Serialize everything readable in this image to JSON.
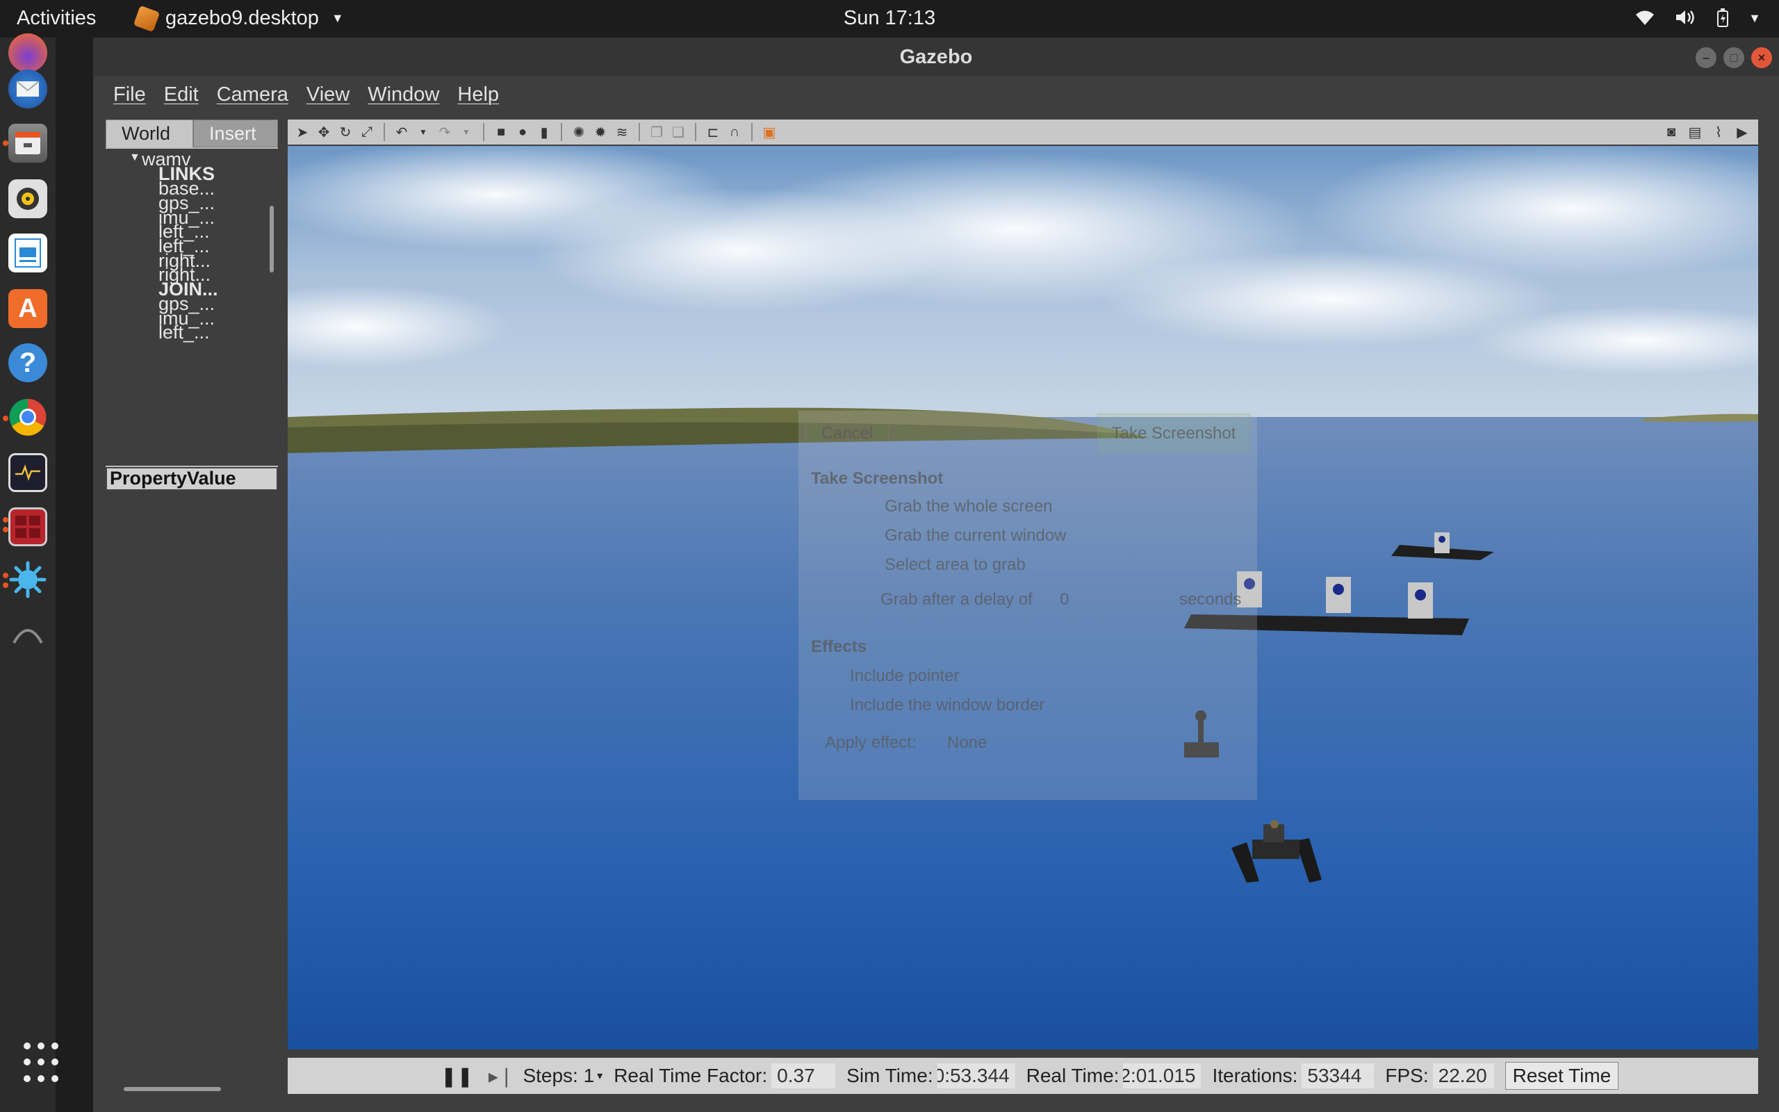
{
  "topbar": {
    "activities": "Activities",
    "app_name": "gazebo9.desktop",
    "clock": "Sun 17:13"
  },
  "dock": {
    "apps": [
      "firefox-icon",
      "thunderbird-icon",
      "files-icon",
      "rhythmbox-icon",
      "libreoffice-writer-icon",
      "software-center-icon",
      "help-icon",
      "chrome-icon",
      "system-monitor-icon",
      "terminal-icon",
      "splash-app-icon",
      "show-apps-icon"
    ]
  },
  "window": {
    "title": "Gazebo"
  },
  "menu": [
    "File",
    "Edit",
    "Camera",
    "View",
    "Window",
    "Help"
  ],
  "left_panel": {
    "tabs": [
      "World",
      "Insert"
    ],
    "tree": {
      "root": "wamv",
      "items": [
        {
          "label": "LINKS",
          "bold": true
        },
        {
          "label": "base...",
          "bold": false
        },
        {
          "label": "gps_...",
          "bold": false
        },
        {
          "label": "imu_...",
          "bold": false
        },
        {
          "label": "left_...",
          "bold": false
        },
        {
          "label": "left_...",
          "bold": false
        },
        {
          "label": "right...",
          "bold": false
        },
        {
          "label": "right...",
          "bold": false
        },
        {
          "label": "JOIN...",
          "bold": true
        },
        {
          "label": "gps_...",
          "bold": false
        },
        {
          "label": "imu_...",
          "bold": false
        },
        {
          "label": "left_...",
          "bold": false
        }
      ]
    },
    "property_header": "PropertyValue"
  },
  "status": {
    "steps_label": "Steps: 1",
    "rtf_label": "Real Time Factor:",
    "rtf_value": "0.37",
    "sim_label": "Sim Time:",
    "sim_value": "0:53.344",
    "real_label": "Real Time:",
    "real_value": "2:01.015",
    "iter_label": "Iterations:",
    "iter_value": "53344",
    "fps_label": "FPS:",
    "fps_value": "22.20",
    "reset_label": "Reset Time"
  },
  "screenshot_dialog": {
    "cancel": "Cancel",
    "take": "Take Screenshot",
    "heading": "Take Screenshot",
    "opt_whole": "Grab the whole screen",
    "opt_window": "Grab the current window",
    "opt_area": "Select area to grab",
    "delay_label": "Grab after a delay of",
    "delay_value": "0",
    "delay_unit": "seconds",
    "effects": "Effects",
    "pointer": "Include pointer",
    "border": "Include the window border",
    "apply": "Apply effect:",
    "apply_value": "None"
  },
  "colors": {
    "accent": "#e95420",
    "panel": "#3e3e3e",
    "water": "#2a66b0",
    "sky": "#b8cce0"
  }
}
